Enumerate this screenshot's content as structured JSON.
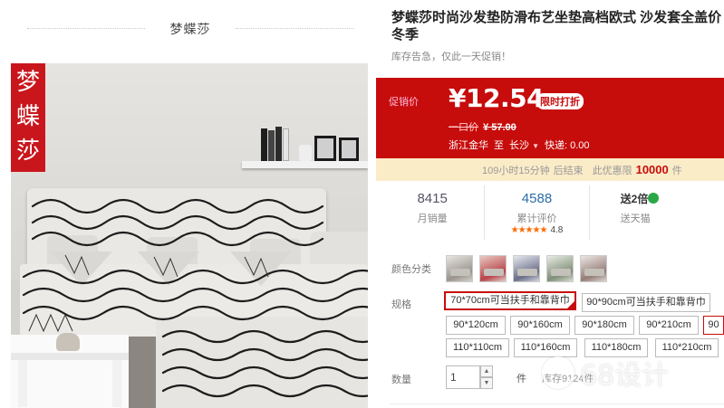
{
  "shop": {
    "name": "梦蝶莎"
  },
  "brand_logo": {
    "chars": [
      "梦",
      "蝶",
      "莎"
    ]
  },
  "product": {
    "title": "梦蝶莎时尚沙发垫防滑布艺坐垫高档欧式 沙发套全盖价冬季",
    "stock_notice": "库存告急，仅此一天促销！"
  },
  "price": {
    "promo_label": "促销价",
    "current": "¥12.54",
    "badge": "限时打折",
    "orig_label": "一口价",
    "orig_value": "¥ 57.00"
  },
  "shipping": {
    "from": "浙江金华",
    "to_word": "至",
    "to": "长沙",
    "express": "快递: 0.00"
  },
  "countdown": {
    "time": "109小时15分钟",
    "ends": "后结束",
    "limit_label": "此优惠限",
    "limit_value": "10000",
    "unit": "件"
  },
  "stats": {
    "monthly_sales_value": "8415",
    "monthly_sales_label": "月销量",
    "reviews_value": "4588",
    "reviews_label": "累计评价",
    "rating": "4.8",
    "stars": "★★★★★",
    "points_value": "送2倍",
    "points_label": "送天猫"
  },
  "options": {
    "color_label": "颜色分类",
    "spec_label": "规格",
    "qty_label": "数量"
  },
  "specs": [
    {
      "label": "70*70cm可当扶手和靠背巾",
      "selected": true
    },
    {
      "label": "90*90cm可当扶手和靠背巾",
      "selected": false
    },
    {
      "label": "90*120cm",
      "selected": false
    },
    {
      "label": "90*160cm",
      "selected": false
    },
    {
      "label": "90*180cm",
      "selected": false
    },
    {
      "label": "90*210cm",
      "selected": false
    },
    {
      "label": "90",
      "selected": false
    },
    {
      "label": "110*110cm",
      "selected": false
    },
    {
      "label": "110*160cm",
      "selected": false
    },
    {
      "label": "110*180cm",
      "selected": false
    },
    {
      "label": "110*210cm",
      "selected": false
    }
  ],
  "quantity": {
    "value": "1",
    "unit": "件",
    "inventory": "库存9124件"
  },
  "colors": {
    "accent": "#c70c0c",
    "countdown_bg": "#fbecc8",
    "link_blue": "#2b6da8",
    "star": "#ff6a00"
  },
  "watermark": {
    "text": "68设计"
  }
}
